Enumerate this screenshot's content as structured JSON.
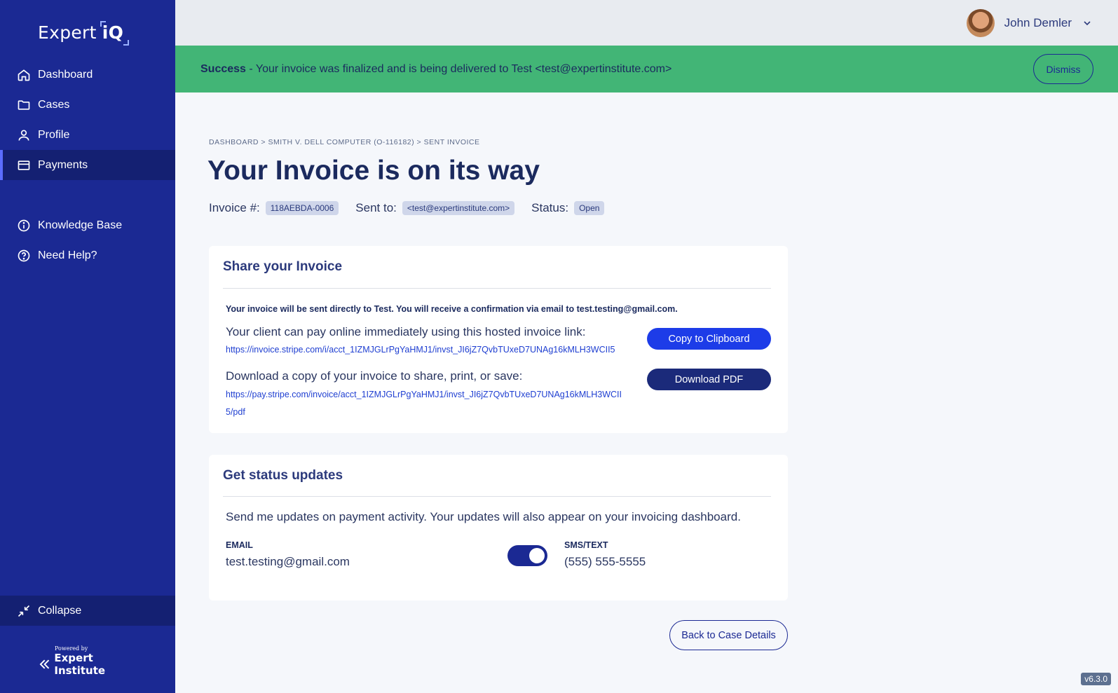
{
  "sidebar": {
    "logo_text": "Expert",
    "logo_accent": "iQ",
    "items": [
      {
        "label": "Dashboard",
        "icon": "home-icon"
      },
      {
        "label": "Cases",
        "icon": "folder-icon"
      },
      {
        "label": "Profile",
        "icon": "user-icon"
      },
      {
        "label": "Payments",
        "icon": "credit-card-icon",
        "active": true
      }
    ],
    "secondary_items": [
      {
        "label": "Knowledge Base",
        "icon": "info-icon"
      },
      {
        "label": "Need Help?",
        "icon": "help-icon"
      }
    ],
    "collapse_label": "Collapse",
    "powered_by": "Powered by",
    "powered_brand": "Expert Institute"
  },
  "header": {
    "user_name": "John Demler"
  },
  "banner": {
    "title": "Success",
    "message": " - Your invoice was finalized and is being delivered to Test <test@expertinstitute.com>",
    "dismiss_label": "Dismiss"
  },
  "main": {
    "breadcrumb": "Dashboard > Smith v. Dell Computer (O-116182) > Sent Invoice",
    "title": "Your Invoice is on its way",
    "invoice_label": "Invoice #:",
    "invoice_number": "118AEBDA-0006",
    "sent_label": "Sent to:",
    "sent_to": "<test@expertinstitute.com>",
    "status_label": "Status:",
    "status": "Open"
  },
  "share": {
    "title": "Share your Invoice",
    "note": "Your invoice will be sent directly to Test. You will receive a confirmation via email to test.testing@gmail.com.",
    "hosted_label": "Your client can pay online immediately using this hosted invoice link:",
    "hosted_link": "https://invoice.stripe.com/i/acct_1IZMJGLrPgYaHMJ1/invst_JI6jZ7QvbTUxeD7UNAg16kMLH3WCII5",
    "copy_label": "Copy to Clipboard",
    "download_label_text": "Download a copy of your invoice to share, print, or save:",
    "pdf_link": "https://pay.stripe.com/invoice/acct_1IZMJGLrPgYaHMJ1/invst_JI6jZ7QvbTUxeD7UNAg16kMLH3WCII5/pdf",
    "pdf_button": "Download PDF"
  },
  "updates": {
    "title": "Get status updates",
    "description": "Send me updates on payment activity. Your updates will also appear on your invoicing dashboard.",
    "email_label": "EMAIL",
    "email_value": "test.testing@gmail.com",
    "sms_label": "SMS/TEXT",
    "sms_value": "(555) 555-5555",
    "sms_enabled": true
  },
  "footer": {
    "back_label": "Back to Case Details",
    "version": "v6.3.0"
  },
  "colors": {
    "sidebar": "#1b2993",
    "success": "#42b576",
    "primary_button": "#1d3ce8"
  }
}
